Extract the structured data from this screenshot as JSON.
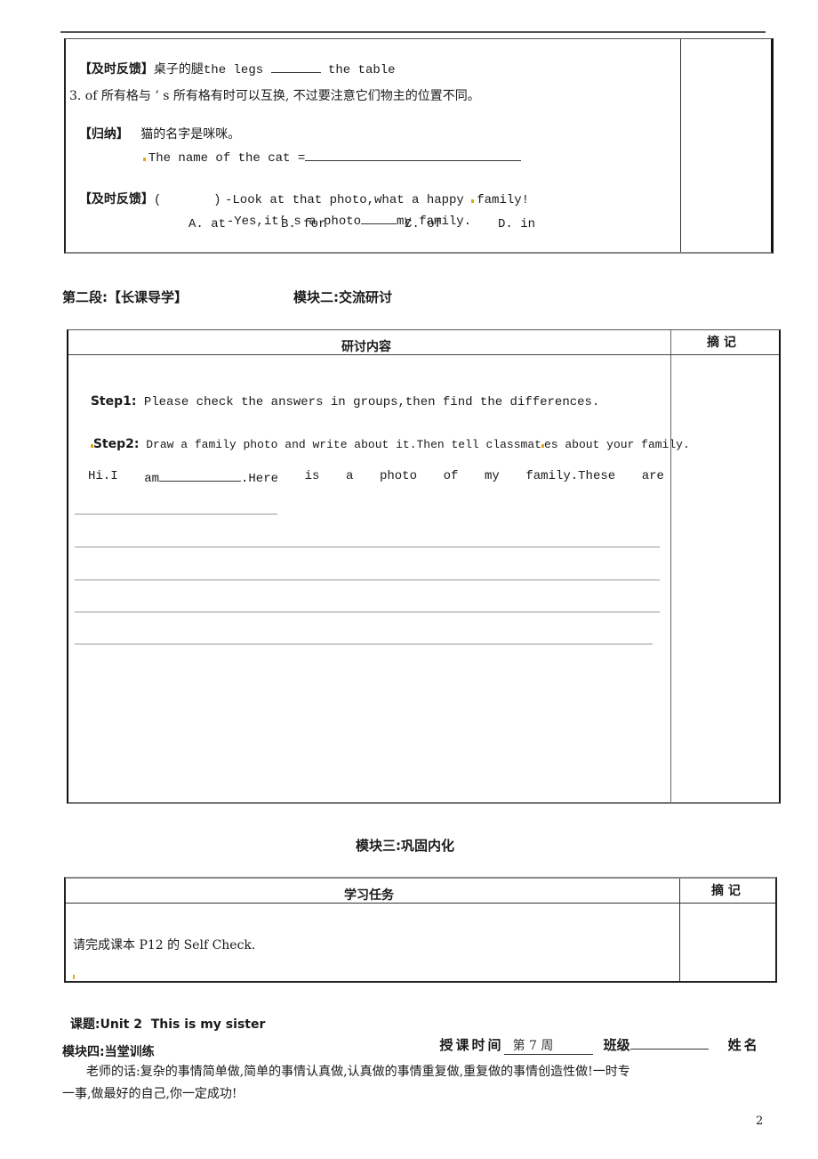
{
  "section_feedback_1": {
    "label": "【及时反馈】",
    "text_cn": "桌子的腿",
    "text_en_a": "the legs ",
    "text_en_b": " the table"
  },
  "point_3": {
    "text": "3. of 所有格与 ’ s 所有格有时可以互换, 不过要注意它们物主的位置不同。"
  },
  "summary": {
    "label": "【归纳】",
    "text": "猫的名字是咪咪。",
    "example": "The name of the cat ="
  },
  "feedback_2": {
    "label": "【及时反馈】",
    "paren": "(       )",
    "q1": "-Look at that photo,what a happy ",
    "q1_end": "family!",
    "q2": "-Yes,it’ s a photo",
    "q2_end": "my family.",
    "options": [
      "A. at",
      "B. for",
      "C. of",
      "D. in"
    ]
  },
  "section2": {
    "stage": "第二段:【长课导学】",
    "module": "模块二:交流研讨"
  },
  "table2": {
    "header_content": "研讨内容",
    "header_notes": "摘 记",
    "step1_label": "Step1:",
    "step1_text": " Please check the answers in groups,then find the differences.",
    "step2_label": "Step2:",
    "step2_text_a": " Draw a family photo and write about it.Then tell classmat",
    "step2_text_b": "es about your family.",
    "hi_words": [
      "Hi.I",
      "am",
      ".Here",
      "is",
      "a",
      "photo",
      "of",
      "my",
      "family.These",
      "are"
    ]
  },
  "module3": {
    "title": "模块三:巩固内化"
  },
  "table3": {
    "header_task": "学习任务",
    "header_notes": "摘 记",
    "task": "请完成课本 P12 的 Self Check."
  },
  "footer": {
    "topic": "课题:Unit 2  This is my sister",
    "time_label": "授课时间",
    "time_value": "第 7 周",
    "class_label": "班级",
    "name_label": "姓名",
    "module4": "模块四:当堂训练",
    "teacher_words_1": "老师的话:复杂的事情简单做,简单的事情认真做,认真做的事情重复做,重复做的事情创造性做!一时专",
    "teacher_words_2": "一事,做最好的自己,你一定成功!",
    "page_number": "2"
  }
}
